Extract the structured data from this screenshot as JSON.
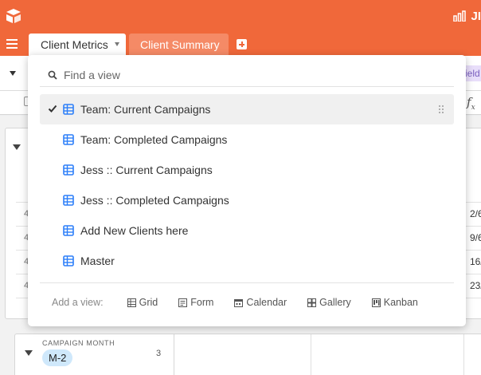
{
  "app": {
    "title_fragment": "JI",
    "brand_color": "#f0683a",
    "icons": {
      "logo": "logo-icon",
      "menu": "hamburger-icon",
      "share": "bar-chart-icon"
    }
  },
  "tabs": [
    {
      "label": "Client Metrics",
      "active": true
    },
    {
      "label": "Client Summary",
      "active": false
    }
  ],
  "toolbar": {
    "fields_fragment": "ield"
  },
  "search": {
    "placeholder": "Find a view",
    "value": ""
  },
  "views": [
    {
      "label": "Team: Current Campaigns",
      "selected": true,
      "icon": "grid-view-icon"
    },
    {
      "label": "Team: Completed Campaigns",
      "selected": false,
      "icon": "grid-view-icon"
    },
    {
      "label": "Jess :: Current Campaigns",
      "selected": false,
      "icon": "grid-view-icon"
    },
    {
      "label": "Jess :: Completed Campaigns",
      "selected": false,
      "icon": "grid-view-icon"
    },
    {
      "label": "Add New Clients here",
      "selected": false,
      "icon": "grid-view-icon"
    },
    {
      "label": "Master",
      "selected": false,
      "icon": "grid-view-icon"
    }
  ],
  "add_view": {
    "label": "Add a view:",
    "options": [
      {
        "label": "Grid",
        "icon": "grid-icon"
      },
      {
        "label": "Form",
        "icon": "form-icon"
      },
      {
        "label": "Calendar",
        "icon": "calendar-icon"
      },
      {
        "label": "Gallery",
        "icon": "gallery-icon"
      },
      {
        "label": "Kanban",
        "icon": "kanban-icon"
      }
    ]
  },
  "background": {
    "row_numbers": [
      "4",
      "4",
      "4",
      "4"
    ],
    "date_cells": [
      "2/6",
      "9/6",
      "16/",
      "23/"
    ],
    "group2": {
      "label": "CAMPAIGN MONTH",
      "value": "M-2",
      "count": "3"
    }
  }
}
